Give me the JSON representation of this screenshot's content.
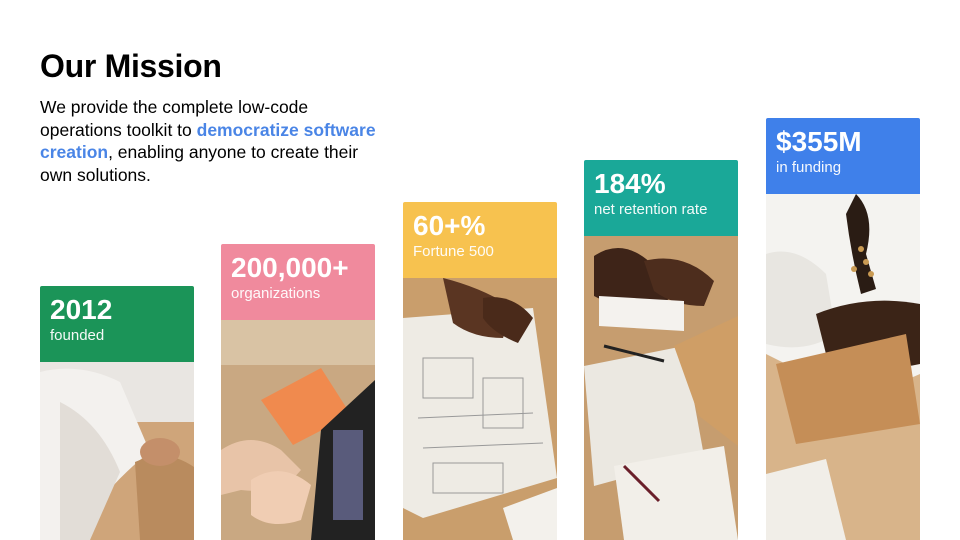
{
  "title": "Our Mission",
  "intro": {
    "before": "We provide the complete low-code operations toolkit to ",
    "highlight": "democratize software creation",
    "after": ", enabling anyone to create their own solutions."
  },
  "accent_color": "#4a85e6",
  "stats": [
    {
      "value": "2012",
      "label": "founded",
      "color": "#1b9458"
    },
    {
      "value": "200,000+",
      "label": "organizations",
      "color": "#f08a9d"
    },
    {
      "value": "60+%",
      "label": "Fortune 500",
      "color": "#f7c24f"
    },
    {
      "value": "184%",
      "label": "net retention rate",
      "color": "#1aa898"
    },
    {
      "value": "$355M",
      "label": "in funding",
      "color": "#3f80ea"
    }
  ]
}
